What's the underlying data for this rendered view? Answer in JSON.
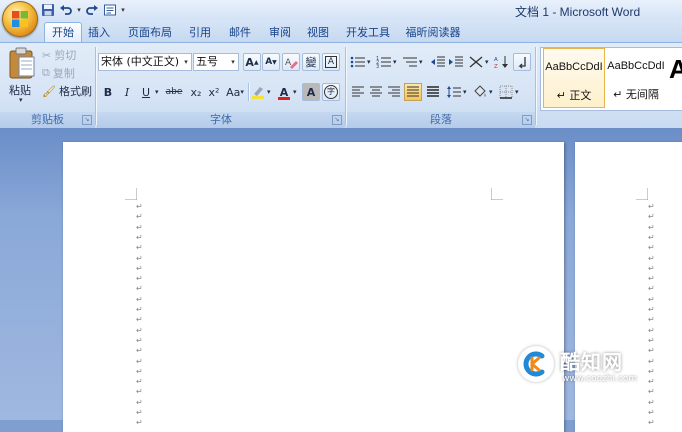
{
  "window": {
    "title": "文档 1 - Microsoft Word"
  },
  "tabs": [
    {
      "label": "开始",
      "active": true
    },
    {
      "label": "插入"
    },
    {
      "label": "页面布局"
    },
    {
      "label": "引用"
    },
    {
      "label": "邮件"
    },
    {
      "label": "审阅"
    },
    {
      "label": "视图"
    },
    {
      "label": "开发工具"
    },
    {
      "label": "福昕阅读器"
    }
  ],
  "clipboard": {
    "paste_label": "粘贴",
    "cut_label": "剪切",
    "copy_label": "复制",
    "format_painter_label": "格式刷",
    "group_label": "剪贴板"
  },
  "font": {
    "font_name": "宋体 (中文正文)",
    "font_size": "五号",
    "group_label": "字体",
    "bold": "B",
    "italic": "I",
    "underline": "U",
    "strikethrough": "abe",
    "subscript": "x₂",
    "superscript": "x²",
    "change_case": "Aa",
    "grow": "A",
    "shrink": "A",
    "font_color_letter": "A",
    "phonetic": "變",
    "char_border": "A",
    "char_shading": "A",
    "enclose": "字"
  },
  "paragraph": {
    "group_label": "段落"
  },
  "styles": {
    "items": [
      {
        "sample": "AaBbCcDdI",
        "name": "↵ 正文",
        "selected": true
      },
      {
        "sample": "AaBbCcDdI",
        "name": "↵ 无间隔"
      }
    ],
    "big_sample": "A"
  },
  "document": {
    "paragraph_mark": "↵",
    "left_page_marks": 22,
    "right_page_marks": 22
  },
  "watermark": {
    "title": "酷知网",
    "url": "www.coozhi.com"
  },
  "colors": {
    "ribbon_accent": "#15428b",
    "highlight": "#f4e23a",
    "font_color": "#e02020"
  }
}
